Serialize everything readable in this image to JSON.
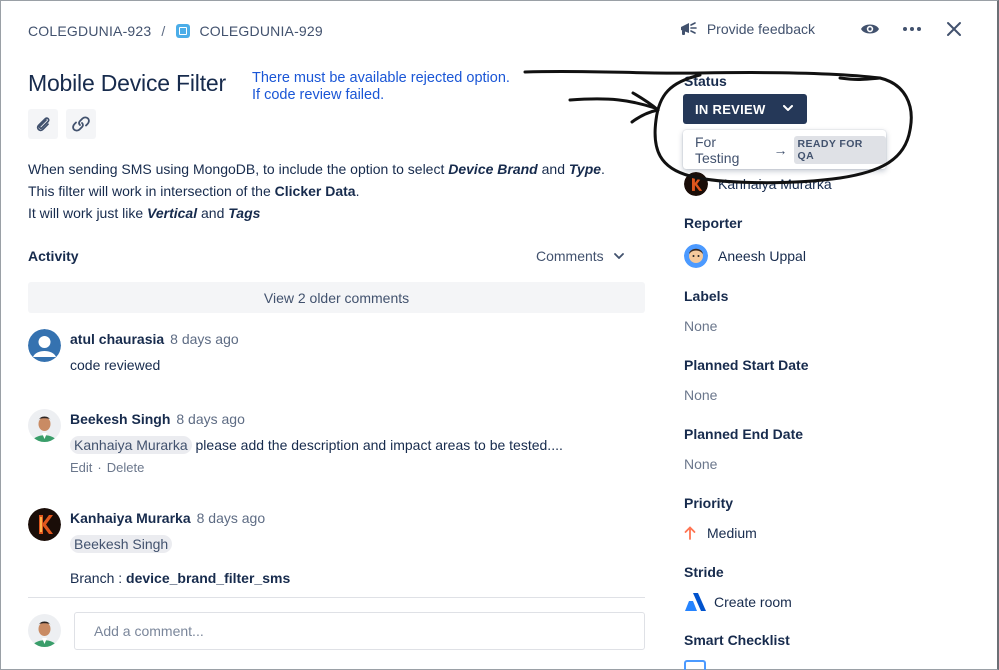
{
  "breadcrumb": {
    "parent": "COLEGDUNIA-923",
    "separator": "/",
    "current": "COLEGDUNIA-929"
  },
  "header": {
    "feedback_label": "Provide feedback"
  },
  "issue": {
    "title": "Mobile Device Filter",
    "annotation_line1": "There must be available rejected option.",
    "annotation_line2": "If code review failed.",
    "description": {
      "l1_a": "When sending SMS using MongoDB, to include the option to select ",
      "l1_b": "Device Brand",
      "l1_c": " and ",
      "l1_d": "Type",
      "l1_e": ".",
      "l2_a": "This filter will work in intersection of the ",
      "l2_b": "Clicker Data",
      "l2_c": ".",
      "l3_a": "It will work just like ",
      "l3_b": "Vertical",
      "l3_c": " and ",
      "l3_d": "Tags"
    }
  },
  "activity": {
    "label": "Activity",
    "filter_label": "Comments",
    "older_comments": "View 2 older comments",
    "comments": [
      {
        "author": "atul chaurasia",
        "time": "8 days ago",
        "text": "code reviewed"
      },
      {
        "author": "Beekesh Singh",
        "time": "8 days ago",
        "mention": "Kanhaiya Murarka",
        "text": " please add the description and impact areas to be tested....",
        "edit": "Edit",
        "dot": "·",
        "delete": "Delete"
      },
      {
        "author": "Kanhaiya Murarka",
        "time": "8 days ago",
        "mention": "Beekesh Singh",
        "branch_label": "Branch : ",
        "branch_value": "device_brand_filter_sms"
      }
    ],
    "add_comment_placeholder": "Add a comment..."
  },
  "sidebar": {
    "status_label": "Status",
    "status_value": "IN REVIEW",
    "transition_label": "For Testing",
    "transition_arrow": "→",
    "transition_target": "READY FOR QA",
    "assignee": "Kanhaiya Murarka",
    "reporter_label": "Reporter",
    "reporter": "Aneesh Uppal",
    "labels_label": "Labels",
    "labels_value": "None",
    "planned_start_label": "Planned Start Date",
    "planned_start_value": "None",
    "planned_end_label": "Planned End Date",
    "planned_end_value": "None",
    "priority_label": "Priority",
    "priority_value": "Medium",
    "stride_label": "Stride",
    "stride_value": "Create room",
    "checklist_label": "Smart Checklist"
  },
  "colors": {
    "status_bg": "#253858",
    "priority_orange": "#FF7452",
    "annotation_blue": "#1a56d6",
    "stride_blue": "#0052CC"
  }
}
